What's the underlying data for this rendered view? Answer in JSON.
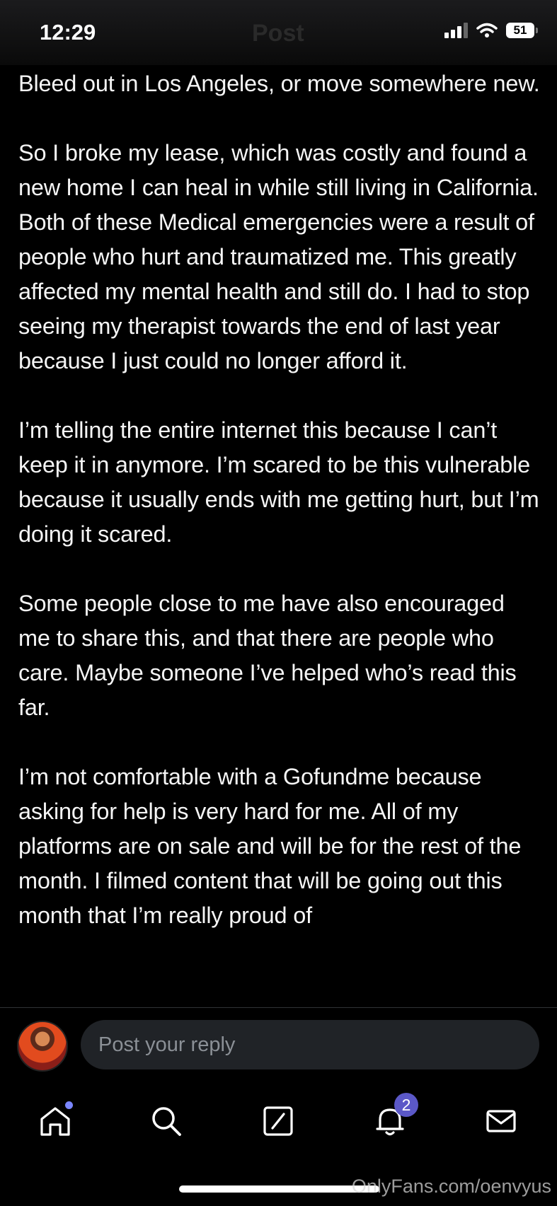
{
  "status_bar": {
    "time": "12:29",
    "header_title": "Post",
    "battery": "51",
    "icons": [
      "cellular-signal-icon",
      "wifi-icon",
      "battery-icon"
    ]
  },
  "post": {
    "paragraphs": [
      "Bleed out in Los Angeles, or move somewhere new.",
      "So I broke my lease, which was costly and found a new home I can heal in while still living in California. Both of these Medical emergencies were a result of people who hurt and traumatized me. This greatly affected my mental health and still do. I had to stop seeing my therapist towards the end of last year because I just could no longer afford it.",
      "I’m telling the entire internet this because I can’t keep it in anymore. I’m scared to be this vulnerable because it usually ends with me getting hurt, but I’m doing it scared.",
      "Some people close to me have also encouraged me to share this, and that there are people who care. Maybe someone I’ve helped who’s read this far.",
      "I’m not comfortable with a Gofundme because asking for help is very hard for me. All of my platforms are on sale and will be for the rest of the month. I filmed content that will be going out this month that I’m really proud of"
    ]
  },
  "reply": {
    "placeholder": "Post your reply"
  },
  "nav": {
    "items": [
      {
        "name": "home",
        "icon": "home-icon",
        "has_dot": true
      },
      {
        "name": "search",
        "icon": "search-icon"
      },
      {
        "name": "compose",
        "icon": "compose-icon"
      },
      {
        "name": "notifications",
        "icon": "bell-icon",
        "badge": "2"
      },
      {
        "name": "messages",
        "icon": "mail-icon"
      }
    ],
    "accent": "#5b58c7"
  },
  "watermark": "OnlyFans.com/oenvyus"
}
